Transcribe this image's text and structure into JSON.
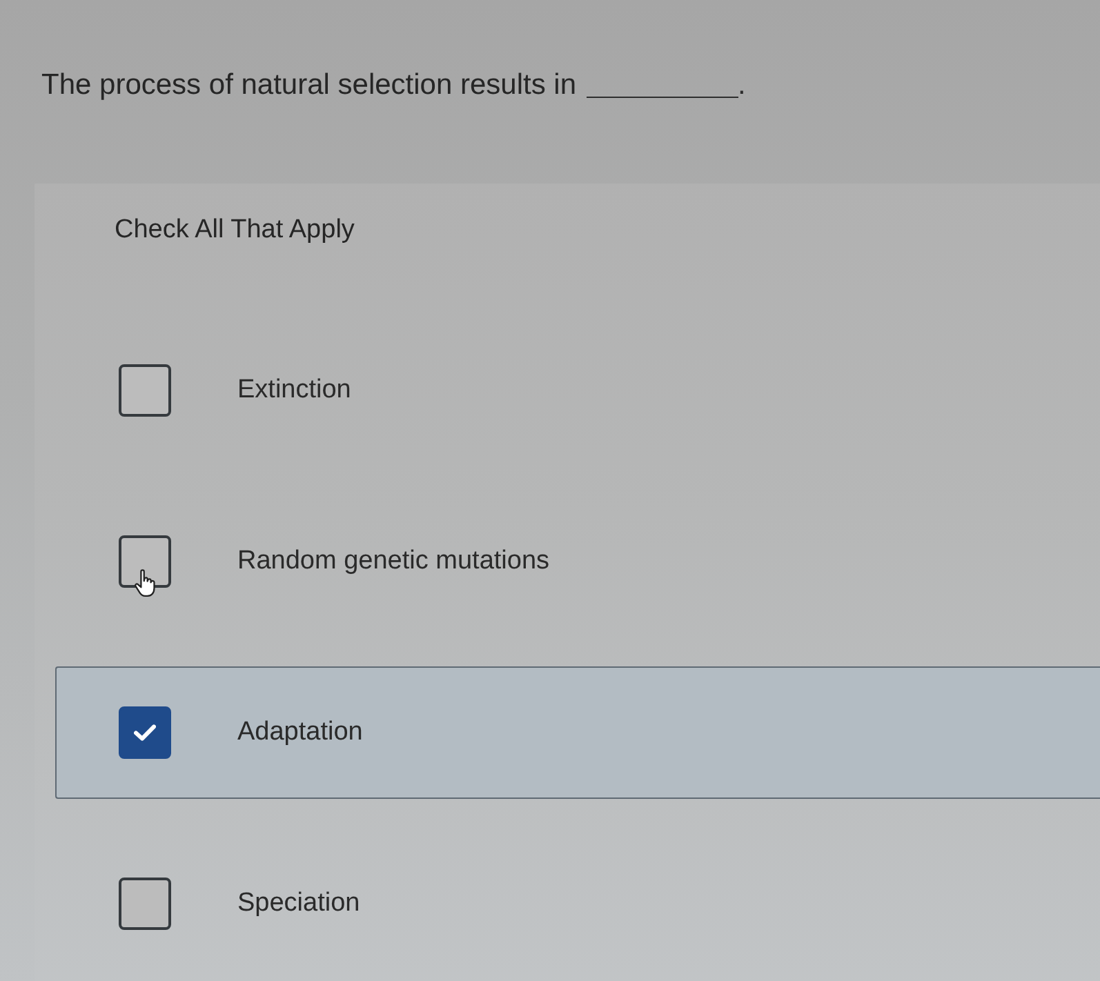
{
  "question": {
    "text": "The process of natural selection results in",
    "after_blank": "."
  },
  "instruction": "Check All That Apply",
  "options": [
    {
      "label": "Extinction",
      "checked": false,
      "hovered": false
    },
    {
      "label": "Random genetic mutations",
      "checked": false,
      "hovered": true
    },
    {
      "label": "Adaptation",
      "checked": true,
      "hovered": false
    },
    {
      "label": "Speciation",
      "checked": false,
      "hovered": false
    }
  ]
}
